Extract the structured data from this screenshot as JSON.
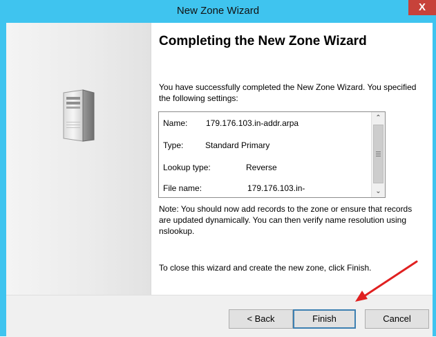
{
  "window": {
    "title": "New Zone Wizard",
    "close_label": "X"
  },
  "page": {
    "heading": "Completing the New Zone Wizard",
    "intro": "You have successfully completed the New Zone Wizard. You specified the following settings:",
    "settings": [
      {
        "label": "Name:",
        "value": "179.176.103.in-addr.arpa"
      },
      {
        "label": "Type:",
        "value": "Standard Primary"
      },
      {
        "label": "Lookup type:",
        "value": "Reverse"
      },
      {
        "label": "File name:",
        "value": "179.176.103.in-"
      }
    ],
    "note": "Note: You should now add records to the zone or ensure that records are updated dynamically. You can then verify name resolution using nslookup.",
    "closing": "To close this wizard and create the new zone, click Finish."
  },
  "buttons": {
    "back": "< Back",
    "finish": "Finish",
    "cancel": "Cancel"
  },
  "colors": {
    "titlebar": "#3fc4ef",
    "close": "#c7423a",
    "annotation_arrow": "#e02020",
    "default_button_border": "#3c7fb1"
  },
  "icons": {
    "server": "server-tower-icon",
    "scroll_up": "chevron-up-icon",
    "scroll_down": "chevron-down-icon",
    "annotation": "red-arrow-annotation"
  }
}
